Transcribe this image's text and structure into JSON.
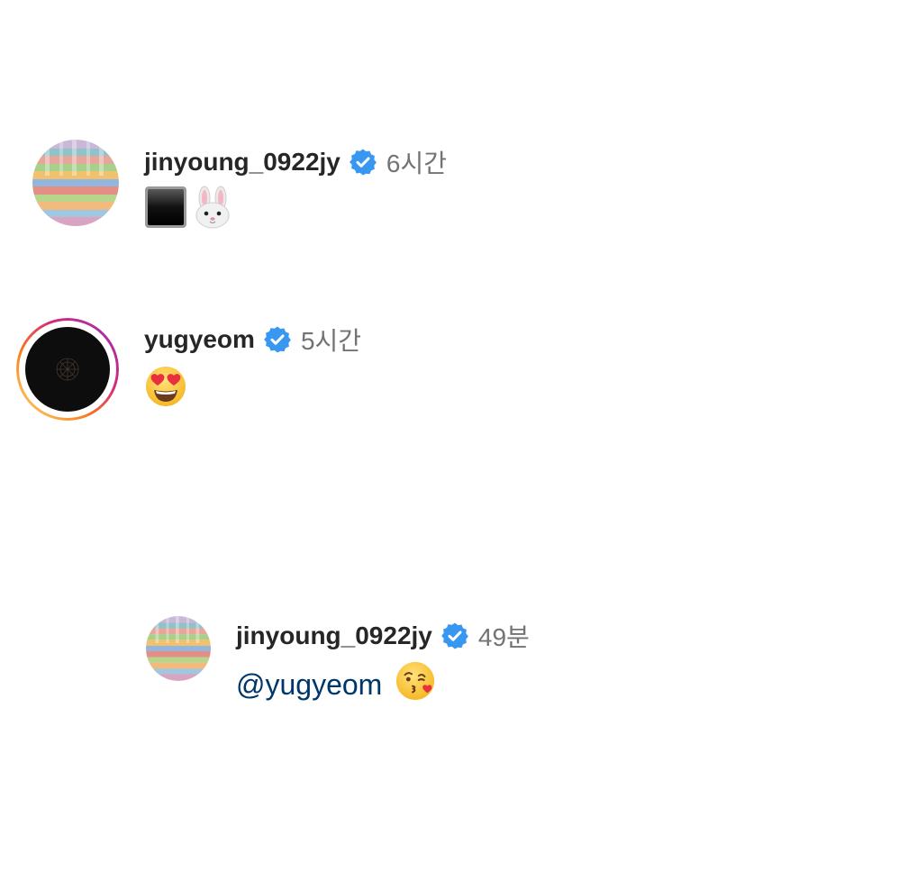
{
  "comments": [
    {
      "username": "jinyoung_0922jy",
      "time": "6시간",
      "verified": true,
      "avatar_icon": "striped-knit-avatar",
      "body_emojis": [
        "⬛",
        "🐰"
      ]
    },
    {
      "username": "yugyeom",
      "time": "5시간",
      "verified": true,
      "story_ring": true,
      "avatar_icon": "black-circle-avatar",
      "body_emojis": [
        "😍"
      ]
    }
  ],
  "reply": {
    "username": "jinyoung_0922jy",
    "time": "49분",
    "verified": true,
    "avatar_icon": "striped-knit-avatar",
    "mention": "@yugyeom",
    "body_emojis": [
      "😘"
    ]
  },
  "colors": {
    "username": "#262626",
    "timestamp": "#737373",
    "verified_badge": "#3897f0",
    "mention": "#00376b",
    "story_ring_start": "#feda75",
    "story_ring_end": "#c13584"
  }
}
